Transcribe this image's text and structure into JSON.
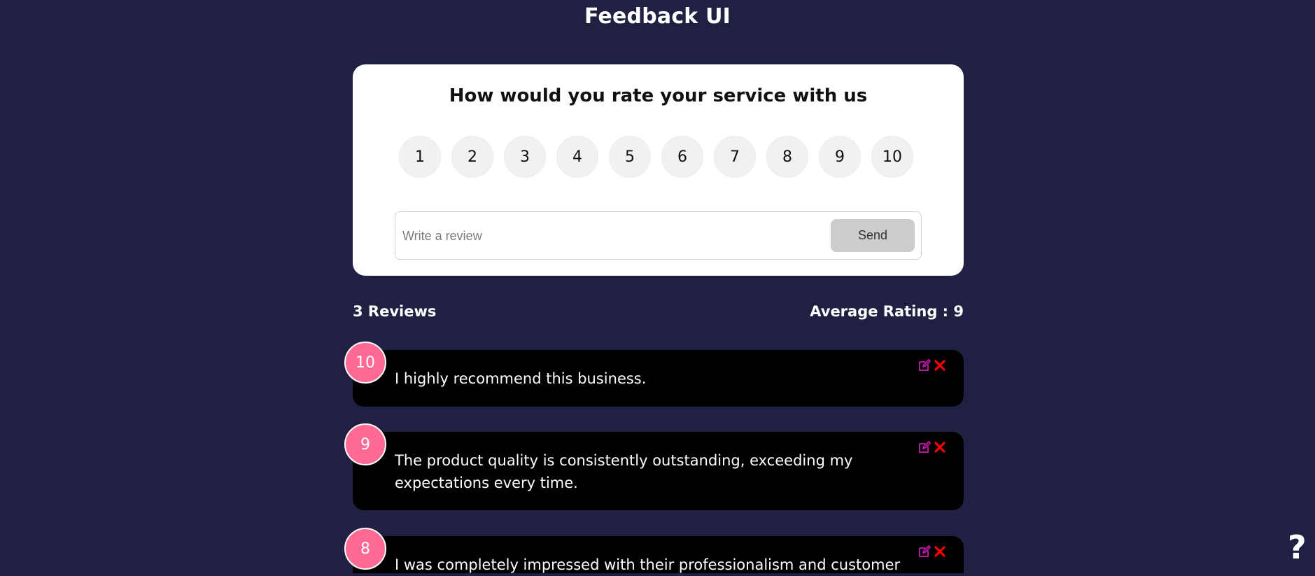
{
  "header": {
    "title": "Feedback UI"
  },
  "form": {
    "question": "How would you rate your service with us",
    "ratings": [
      "1",
      "2",
      "3",
      "4",
      "5",
      "6",
      "7",
      "8",
      "9",
      "10"
    ],
    "review_placeholder": "Write a review",
    "review_value": "",
    "send_label": "Send"
  },
  "stats": {
    "count_label": "3 Reviews",
    "average_label": "Average Rating : 9"
  },
  "reviews": [
    {
      "rating": "10",
      "text": "I highly recommend this business."
    },
    {
      "rating": "9",
      "text": "The product quality is consistently outstanding, exceeding my expectations every time."
    },
    {
      "rating": "8",
      "text": "I was completely impressed with their professionalism and customer"
    }
  ],
  "colors": {
    "background": "#202142",
    "card": "#ffffff",
    "badge": "#ff6a95",
    "review_bg": "#000000",
    "edit_icon": "#b5179e",
    "delete_icon": "#ff0000",
    "send_bg": "#cccccc"
  },
  "icons": {
    "edit": "edit-icon",
    "delete": "close-icon",
    "help": "help-icon"
  }
}
